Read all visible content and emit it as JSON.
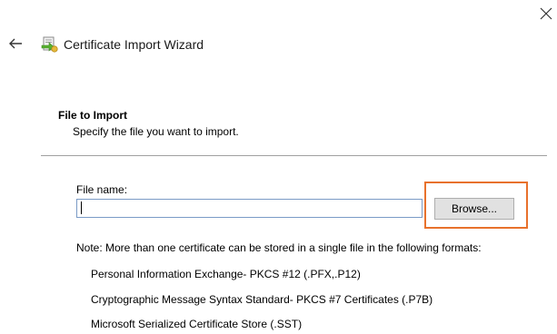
{
  "window": {
    "title": "Certificate Import Wizard",
    "close_icon": "close-icon",
    "back_icon": "back-arrow-icon",
    "wizard_icon": "certificate-icon"
  },
  "section": {
    "title": "File to Import",
    "description": "Specify the file you want to import."
  },
  "file_field": {
    "label": "File name:",
    "value": "",
    "placeholder": ""
  },
  "browse_button": {
    "label": "Browse..."
  },
  "note": "Note:  More than one certificate can be stored in a single file in the following formats:",
  "formats": [
    "Personal Information Exchange- PKCS #12 (.PFX,.P12)",
    "Cryptographic Message Syntax Standard- PKCS #7 Certificates (.P7B)",
    "Microsoft Serialized Certificate Store (.SST)"
  ],
  "colors": {
    "highlight": "#e8712c",
    "input_border": "#7a9bc6",
    "button_bg": "#e1e1e1",
    "divider": "#a0a0a0"
  }
}
